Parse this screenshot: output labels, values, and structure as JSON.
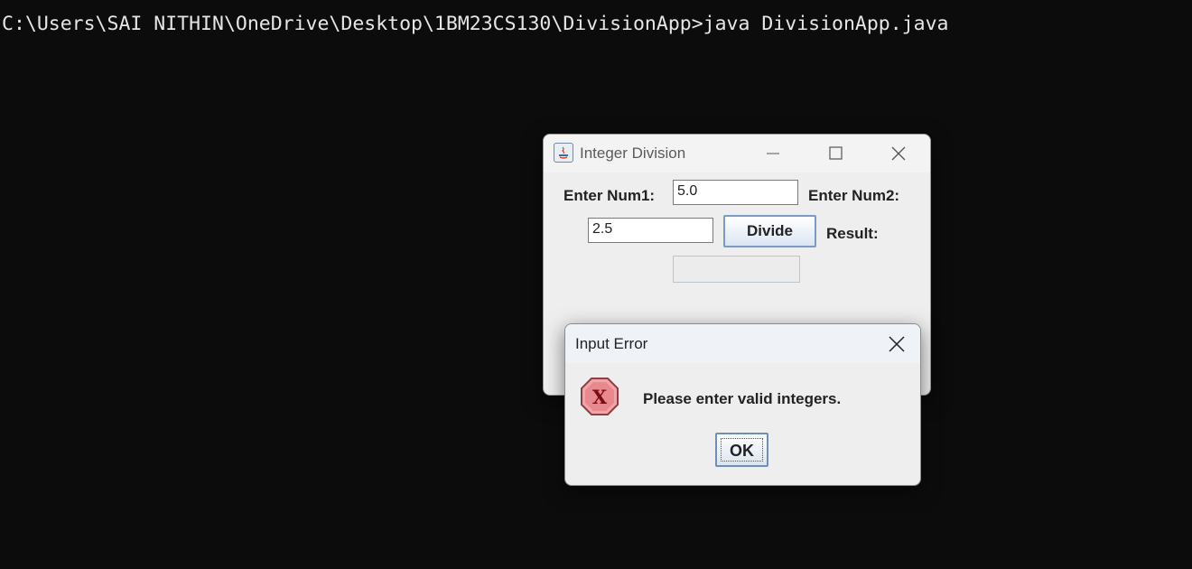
{
  "terminal": {
    "command_line": "C:\\Users\\SAI NITHIN\\OneDrive\\Desktop\\1BM23CS130\\DivisionApp>java DivisionApp.java"
  },
  "main_window": {
    "title": "Integer Division",
    "icon": "java-icon",
    "num1_label": "Enter Num1:",
    "num1_value": "5.0",
    "num2_label": "Enter Num2:",
    "num2_value": "2.5",
    "divide_label": "Divide",
    "result_label": "Result:",
    "result_value": ""
  },
  "dialog": {
    "title": "Input Error",
    "icon": "error-icon",
    "message": "Please enter valid integers.",
    "ok_label": "OK"
  },
  "colors": {
    "terminal_bg": "#0c0c0c",
    "error_icon": "#e8868c",
    "button_border": "#7b9ac4"
  }
}
